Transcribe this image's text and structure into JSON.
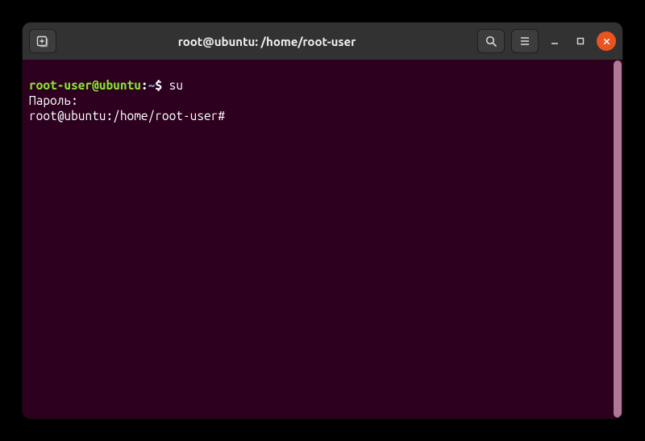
{
  "titlebar": {
    "title": "root@ubuntu: /home/root-user"
  },
  "terminal": {
    "line1": {
      "user": "root-user@ubuntu",
      "colon": ":",
      "path": "~",
      "symbol": "$ ",
      "command": "su"
    },
    "line2": "Пароль:",
    "line3": "root@ubuntu:/home/root-user# "
  }
}
